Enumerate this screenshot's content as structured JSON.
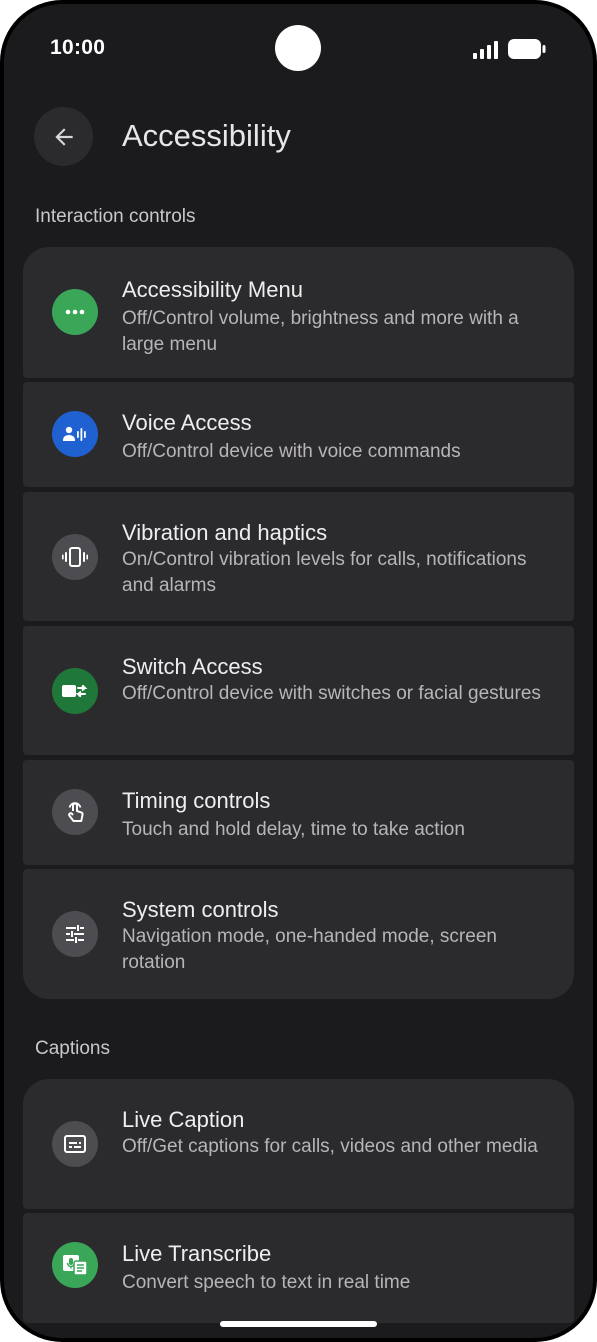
{
  "status_bar": {
    "time": "10:00"
  },
  "header": {
    "title": "Accessibility"
  },
  "sections": [
    {
      "title": "Interaction controls",
      "items": [
        {
          "title": "Accessibility Menu",
          "subtitle": "Off/Control volume, brightness and more with a large menu",
          "icon": "more-horiz-icon",
          "icon_bg": "#3aa658"
        },
        {
          "title": "Voice Access",
          "subtitle": "Off/Control device with voice commands",
          "icon": "voice-access-icon",
          "icon_bg": "#1f61d1"
        },
        {
          "title": "Vibration and haptics",
          "subtitle": "On/Control vibration levels for calls, notifications and alarms",
          "icon": "vibration-icon",
          "icon_bg": "#4d4c51"
        },
        {
          "title": "Switch Access",
          "subtitle": "Off/Control device with switches or facial gestures",
          "icon": "switch-access-icon",
          "icon_bg": "#20773a"
        },
        {
          "title": "Timing controls",
          "subtitle": "Touch and hold delay, time to take action",
          "icon": "touch-icon",
          "icon_bg": "#4d4c51"
        },
        {
          "title": "System controls",
          "subtitle": "Navigation mode, one-handed mode, screen rotation",
          "icon": "tune-icon",
          "icon_bg": "#4d4c51"
        }
      ]
    },
    {
      "title": "Captions",
      "items": [
        {
          "title": "Live Caption",
          "subtitle": "Off/Get captions for calls, videos and other media",
          "icon": "caption-icon",
          "icon_bg": "#4d4c51"
        },
        {
          "title": "Live Transcribe",
          "subtitle": "Convert speech to text in real time",
          "icon": "transcribe-icon",
          "icon_bg": "#3aa658"
        }
      ]
    }
  ]
}
